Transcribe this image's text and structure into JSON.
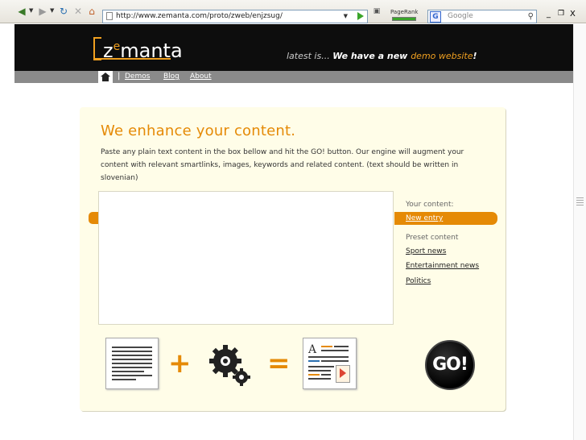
{
  "browser": {
    "url": "http://www.zemanta.com/proto/zweb/enjzsug/",
    "search_placeholder": "Google",
    "pagerank_label": "PageRank",
    "window_controls": [
      "_",
      "вЂ ",
      "X"
    ]
  },
  "site": {
    "logo_prefix": "z",
    "logo_e": "e",
    "logo_rest": "manta",
    "tagline_prefix": "latest is... ",
    "tagline_strong": "We have a new ",
    "tagline_highlight": "demo website",
    "tagline_end": "!"
  },
  "nav": {
    "items": [
      "Demos",
      "Blog",
      "About"
    ]
  },
  "content": {
    "heading": "We enhance your content.",
    "description": "Paste any plain text content in the box bellow and hit the GO! button. Our engine will augment your content with relevant smartlinks, images, keywords and related content. (text should be written in slovenian)",
    "your_content_label": "Your content:",
    "new_entry": "New entry",
    "preset_label": "Preset content",
    "presets": [
      "Sport news",
      "Entertainment news",
      "Politics"
    ],
    "go_label": "GO!"
  },
  "illustration": {
    "plus": "+",
    "equals": "=",
    "enriched_letter": "A"
  },
  "colors": {
    "accent": "#e58a06",
    "header_bg": "#0d0d0d",
    "nav_bg": "#8a8a8a",
    "panel_bg": "#fffde8"
  }
}
